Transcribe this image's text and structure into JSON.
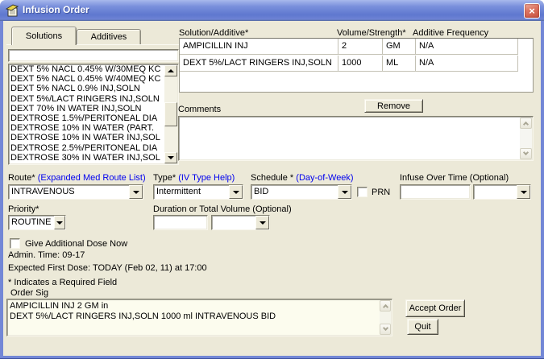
{
  "window": {
    "title": "Infusion Order",
    "close_glyph": "×"
  },
  "tabs": {
    "solutions": "Solutions",
    "additives": "Additives"
  },
  "solution_picker": {
    "filter_value": "",
    "items": [
      "DEXT 5% NACL 0.45% W/30MEQ KC",
      "DEXT 5% NACL 0.45% W/40MEQ KC",
      "DEXT 5% NACL 0.9% INJ,SOLN",
      "DEXT 5%/LACT RINGERS INJ,SOLN",
      "DEXT 70% IN WATER INJ,SOLN",
      "DEXTROSE 1.5%/PERITONEAL DIA",
      "DEXTROSE 10% IN WATER (PART.",
      "DEXTROSE 10% IN WATER INJ,SOL",
      "DEXTROSE 2.5%/PERITONEAL DIA",
      "DEXTROSE 30% IN WATER INJ,SOL"
    ]
  },
  "iv_table": {
    "columns": [
      "Solution/Additive*",
      "Volume/Strength*",
      "Additive Frequency"
    ],
    "rows": [
      {
        "name": "AMPICILLIN INJ",
        "amount": "2",
        "unit": "GM",
        "frequency": "N/A"
      },
      {
        "name": "DEXT 5%/LACT RINGERS INJ,SOLN",
        "amount": "1000",
        "unit": "ML",
        "frequency": "N/A"
      }
    ]
  },
  "remove_button": "Remove",
  "comments": {
    "label": "Comments",
    "value": ""
  },
  "route": {
    "label": "Route*",
    "link": "(Expanded Med Route List)",
    "value": "INTRAVENOUS"
  },
  "iv_type": {
    "label": "Type*",
    "link": "(IV Type Help)",
    "value": "Intermittent"
  },
  "schedule": {
    "label": "Schedule *",
    "link": "(Day-of-Week)",
    "value": "BID",
    "prn_label": "PRN"
  },
  "infuse_over_time": {
    "label": "Infuse Over Time (Optional)",
    "time_value": "",
    "unit_value": ""
  },
  "priority": {
    "label": "Priority*",
    "value": "ROUTINE"
  },
  "duration": {
    "label": "Duration or Total Volume (Optional)",
    "value": "",
    "unit_value": ""
  },
  "additional_dose": {
    "label": "Give Additional Dose Now"
  },
  "status": {
    "admin_time": "Admin. Time: 09-17",
    "expected_first_dose": "Expected First Dose: TODAY (Feb 02, 11) at 17:00",
    "required_note": "* Indicates a Required Field"
  },
  "order_sig": {
    "label": "Order Sig",
    "line1": "AMPICILLIN INJ 2 GM in",
    "line2": "DEXT 5%/LACT RINGERS INJ,SOLN 1000 ml INTRAVENOUS BID"
  },
  "actions": {
    "accept": "Accept Order",
    "quit": "Quit"
  },
  "colors": {
    "titlebar_blue": "#6d83d4",
    "link_blue": "#0000ee",
    "dialog_bg": "#ece9d8",
    "order_sig_bg": "#fcfcee"
  }
}
